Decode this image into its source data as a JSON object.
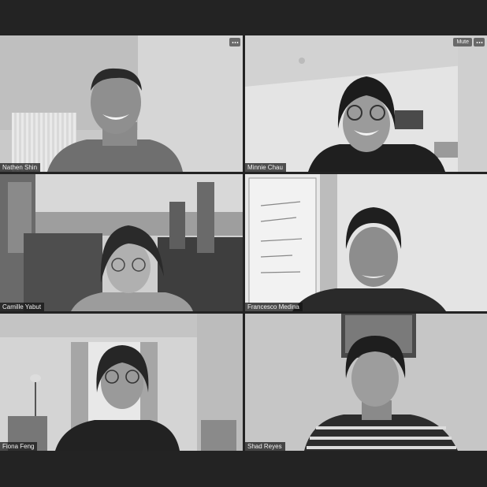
{
  "participants": [
    {
      "name": "Nathen Shin",
      "controls": {
        "more": "more-options"
      }
    },
    {
      "name": "Minnie Chau",
      "controls": {
        "mute": "Mute",
        "more": "more-options"
      }
    },
    {
      "name": "Camille Yabut"
    },
    {
      "name": "Francesco Medina"
    },
    {
      "name": "Fiona Feng"
    },
    {
      "name": "Shad Reyes"
    }
  ],
  "colors": {
    "background": "#232323",
    "tile": "#bdbdbd",
    "name_tag": "#141414"
  }
}
